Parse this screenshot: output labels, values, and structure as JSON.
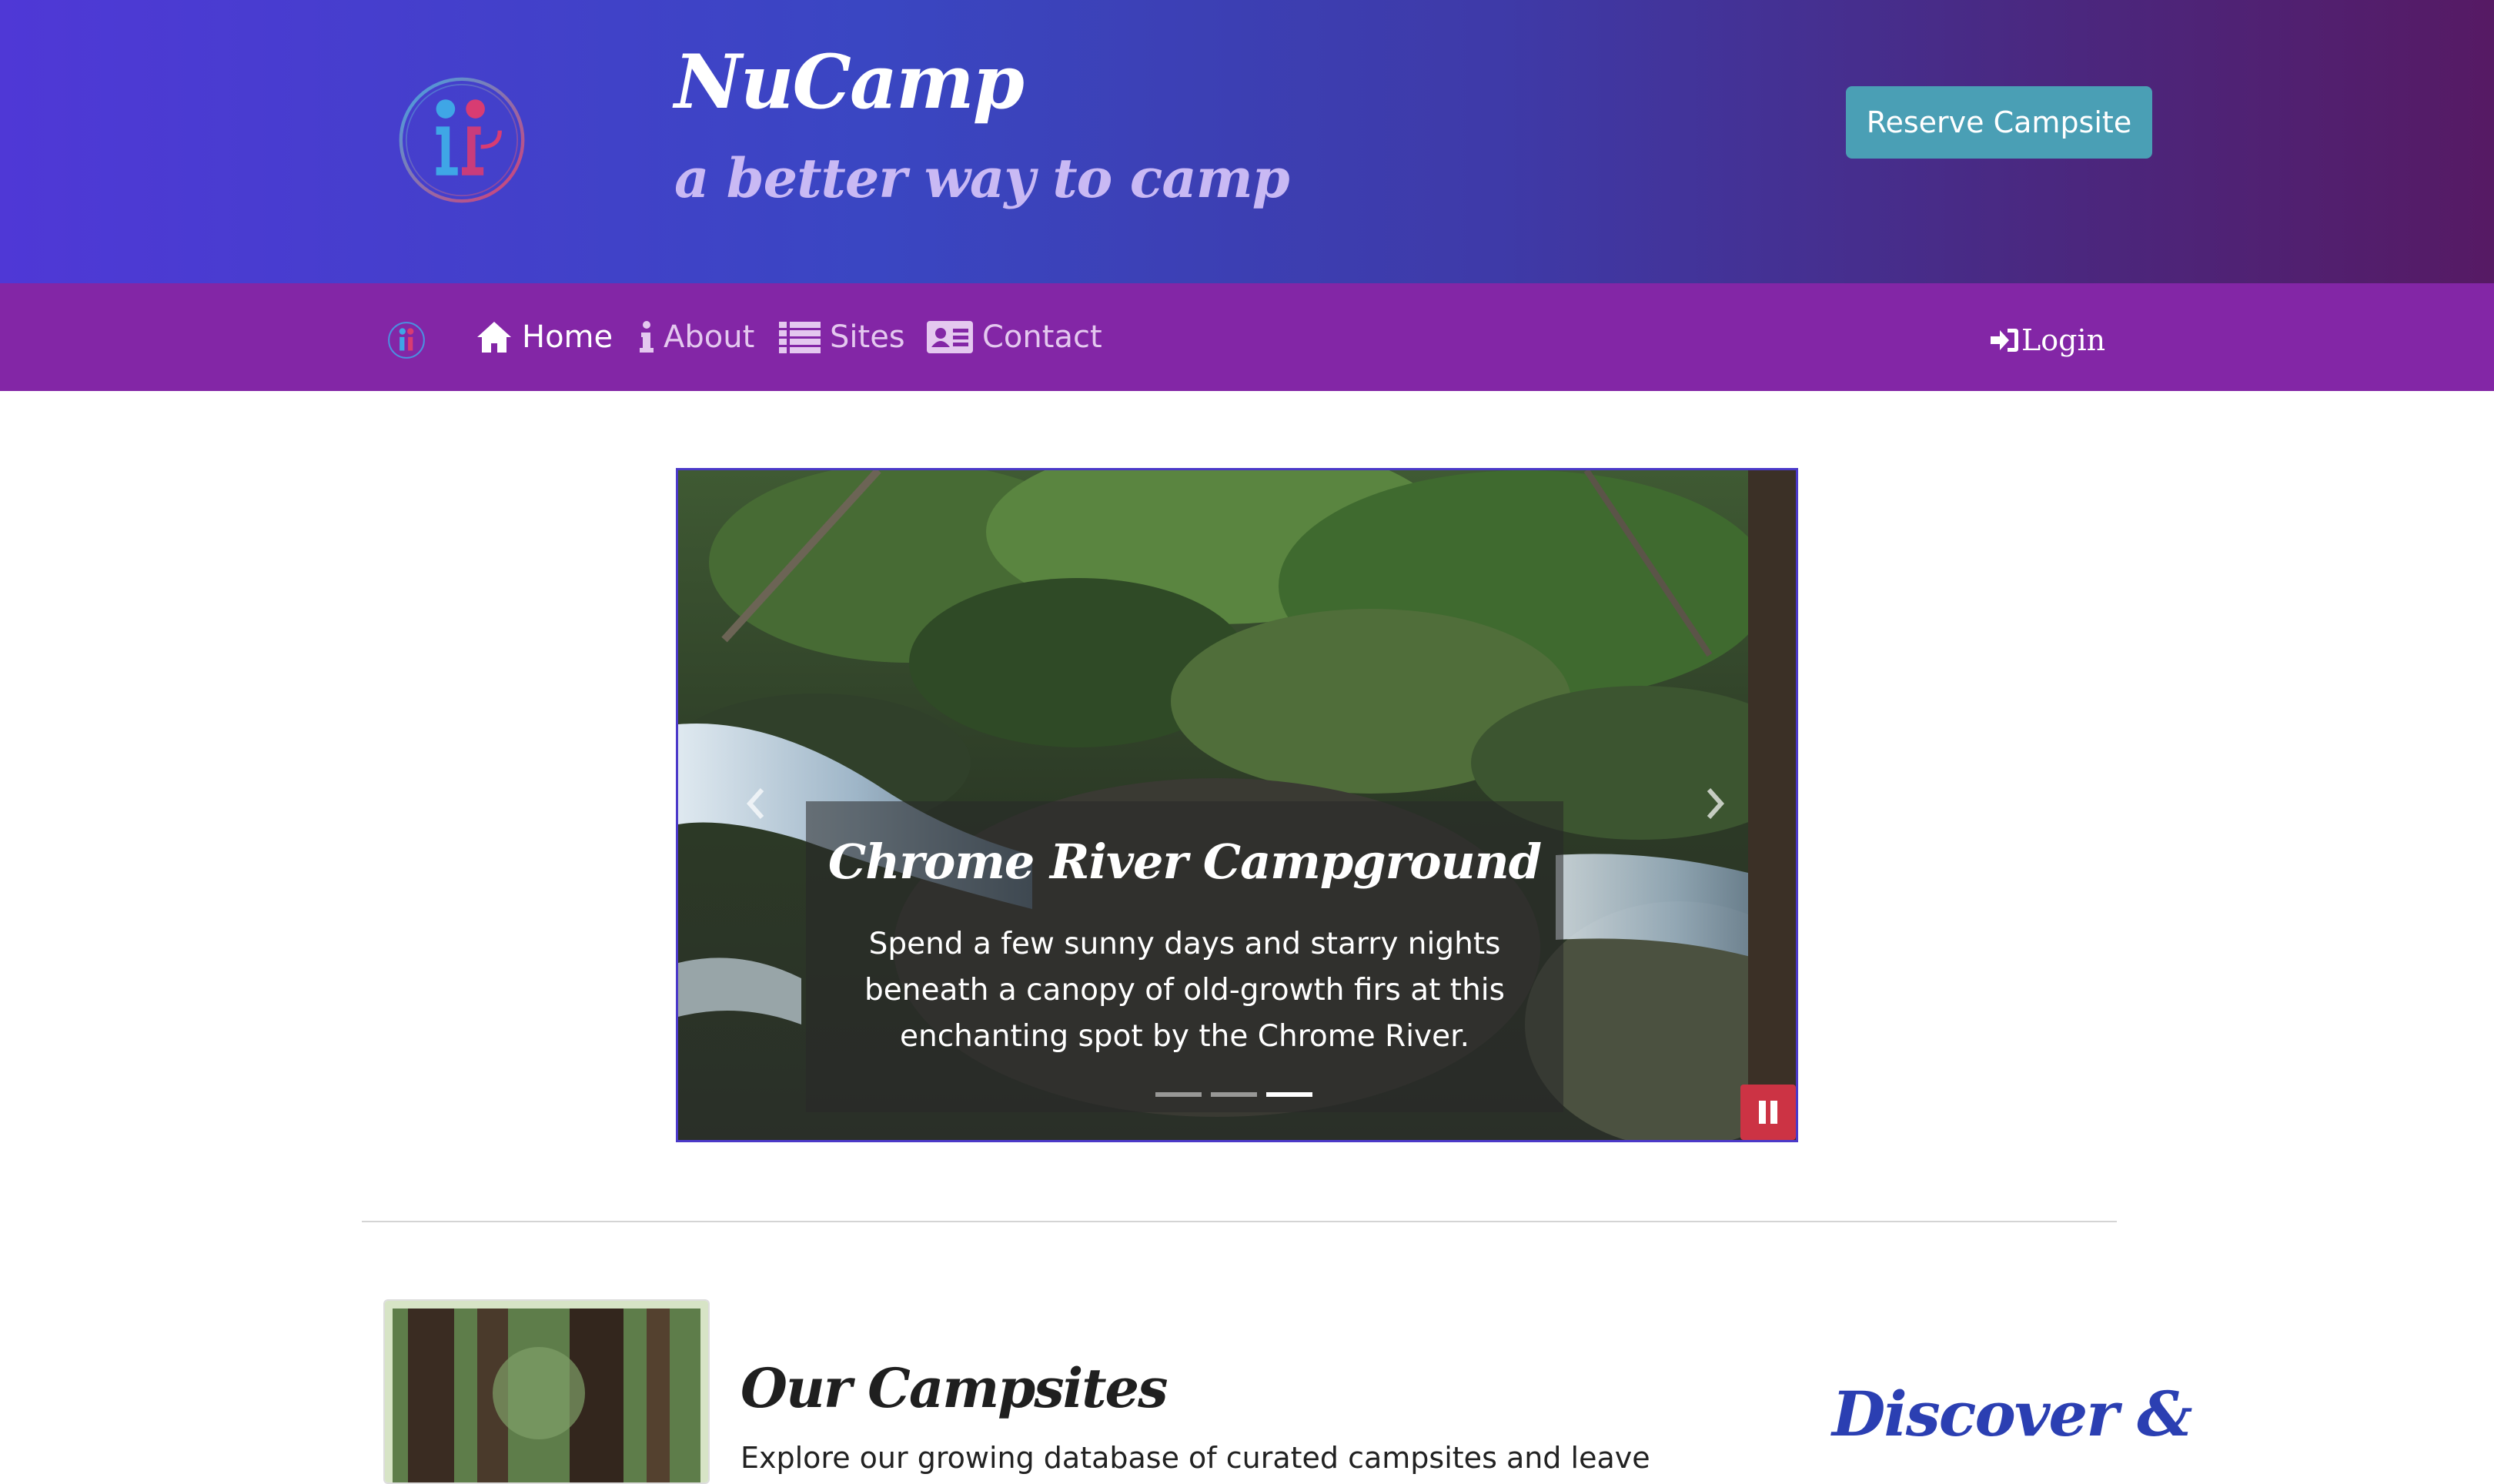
{
  "header": {
    "brand_title": "NuCamp",
    "tagline": "a better way to camp",
    "reserve_label": "Reserve Campsite"
  },
  "nav": {
    "items": [
      {
        "label": "Home",
        "icon": "home-icon",
        "active": true
      },
      {
        "label": "About",
        "icon": "info-icon",
        "active": false
      },
      {
        "label": "Sites",
        "icon": "list-icon",
        "active": false
      },
      {
        "label": "Contact",
        "icon": "address-card-icon",
        "active": false
      }
    ],
    "login_label": "Login"
  },
  "carousel": {
    "caption_title": "Chrome River Campground",
    "caption_text": "Spend a few sunny days and starry nights beneath a canopy of old-growth firs at this enchanting spot by the Chrome River.",
    "slide_count": 3,
    "active_slide": 3
  },
  "campsites": {
    "title": "Our Campsites",
    "text": "Explore our growing database of curated campsites and leave"
  },
  "side_heading": "Discover &",
  "colors": {
    "navbar": "#8326a6",
    "reserve_button": "#4a9fb5",
    "pause_button": "#cc3344",
    "discover_heading": "#2b3fb2"
  }
}
